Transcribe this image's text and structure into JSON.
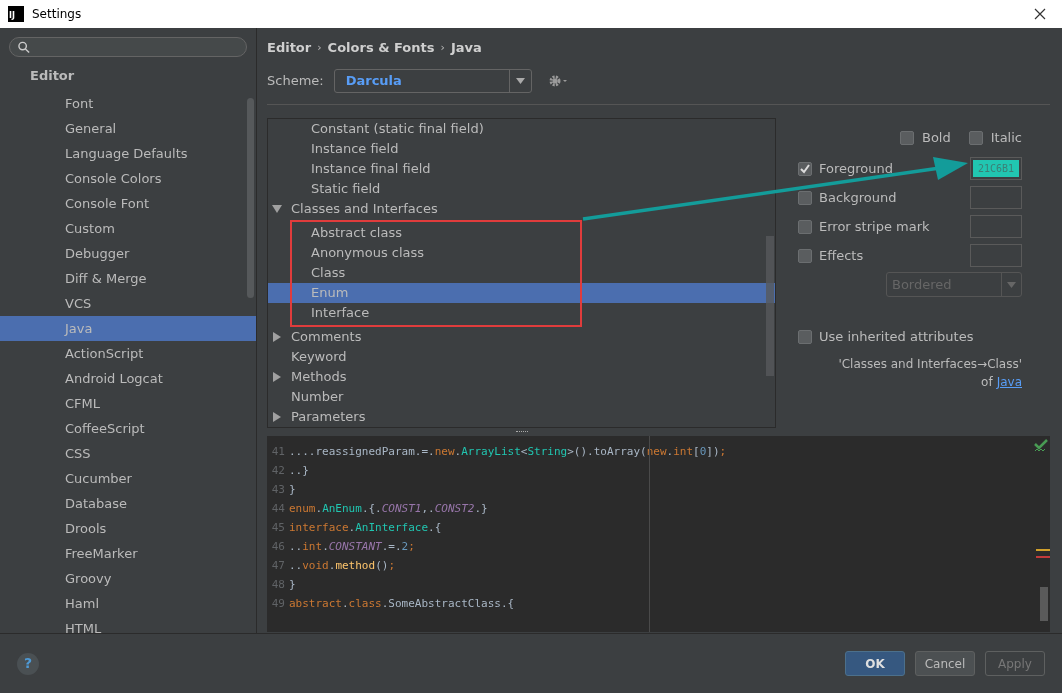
{
  "window": {
    "title": "Settings",
    "app_icon": "IJ"
  },
  "sidebar": {
    "header": "Editor",
    "items": [
      {
        "label": "Font",
        "selected": false
      },
      {
        "label": "General",
        "selected": false
      },
      {
        "label": "Language Defaults",
        "selected": false
      },
      {
        "label": "Console Colors",
        "selected": false
      },
      {
        "label": "Console Font",
        "selected": false
      },
      {
        "label": "Custom",
        "selected": false
      },
      {
        "label": "Debugger",
        "selected": false
      },
      {
        "label": "Diff & Merge",
        "selected": false
      },
      {
        "label": "VCS",
        "selected": false
      },
      {
        "label": "Java",
        "selected": true
      },
      {
        "label": "ActionScript",
        "selected": false
      },
      {
        "label": "Android Logcat",
        "selected": false
      },
      {
        "label": "CFML",
        "selected": false
      },
      {
        "label": "CoffeeScript",
        "selected": false
      },
      {
        "label": "CSS",
        "selected": false
      },
      {
        "label": "Cucumber",
        "selected": false
      },
      {
        "label": "Database",
        "selected": false
      },
      {
        "label": "Drools",
        "selected": false
      },
      {
        "label": "FreeMarker",
        "selected": false
      },
      {
        "label": "Groovy",
        "selected": false
      },
      {
        "label": "Haml",
        "selected": false
      },
      {
        "label": "HTML",
        "selected": false
      }
    ]
  },
  "breadcrumb": {
    "separator": "›",
    "items": [
      "Editor",
      "Colors & Fonts",
      "Java"
    ]
  },
  "scheme": {
    "label": "Scheme:",
    "value": "Darcula"
  },
  "tree": {
    "scrolled_parent_children": [
      {
        "label": "Constant (static final field)",
        "selected": false
      },
      {
        "label": "Instance field",
        "selected": false
      },
      {
        "label": "Instance final field",
        "selected": false
      },
      {
        "label": "Static field",
        "selected": false
      }
    ],
    "items": [
      {
        "label": "Classes and Interfaces",
        "selected": false,
        "expanded": true,
        "children": [
          {
            "label": "Abstract class",
            "selected": false
          },
          {
            "label": "Anonymous class",
            "selected": false
          },
          {
            "label": "Class",
            "selected": false
          },
          {
            "label": "Enum",
            "selected": true
          },
          {
            "label": "Interface",
            "selected": false
          }
        ]
      },
      {
        "label": "Comments",
        "selected": false,
        "expanded": false
      },
      {
        "label": "Keyword",
        "selected": false
      },
      {
        "label": "Methods",
        "selected": false,
        "expanded": false
      },
      {
        "label": "Number",
        "selected": false
      },
      {
        "label": "Parameters",
        "selected": false,
        "expanded": false
      }
    ]
  },
  "attributes": {
    "bold": {
      "label": "Bold",
      "checked": false
    },
    "italic": {
      "label": "Italic",
      "checked": false
    },
    "effects": [
      {
        "label": "Foreground",
        "checked": true,
        "color": "#21c6b1",
        "value": "21C6B1"
      },
      {
        "label": "Background",
        "checked": false
      },
      {
        "label": "Error stripe mark",
        "checked": false
      },
      {
        "label": "Effects",
        "checked": false
      }
    ],
    "effect_type": {
      "value": "Bordered",
      "disabled": true
    },
    "inherit": {
      "label": "Use inherited attributes",
      "checked": false
    },
    "inherit_note": "'Classes and Interfaces→Class'",
    "inherit_of": "of",
    "inherit_link": "Java"
  },
  "preview": {
    "lines": [
      {
        "number": "41",
        "tokens": [
          {
            "kind": "plain",
            "text": "....reassignedParam.=."
          },
          {
            "kind": "keyword",
            "text": "new"
          },
          {
            "kind": "plain",
            "text": "."
          },
          {
            "kind": "class",
            "text": "ArrayList"
          },
          {
            "kind": "plain",
            "text": "<"
          },
          {
            "kind": "class",
            "text": "String"
          },
          {
            "kind": "plain",
            "text": ">().toArray("
          },
          {
            "kind": "keyword",
            "text": "new"
          },
          {
            "kind": "plain",
            "text": "."
          },
          {
            "kind": "keyword",
            "text": "int"
          },
          {
            "kind": "plain",
            "text": "["
          },
          {
            "kind": "number",
            "text": "0"
          },
          {
            "kind": "plain",
            "text": "])"
          },
          {
            "kind": "keyword",
            "text": ";"
          }
        ]
      },
      {
        "number": "42",
        "tokens": [
          {
            "kind": "plain",
            "text": "..}"
          }
        ]
      },
      {
        "number": "43",
        "tokens": [
          {
            "kind": "plain",
            "text": "}"
          }
        ]
      },
      {
        "number": "44",
        "tokens": [
          {
            "kind": "keyword",
            "text": "enum"
          },
          {
            "kind": "plain",
            "text": "."
          },
          {
            "kind": "class",
            "text": "AnEnum"
          },
          {
            "kind": "plain",
            "text": ".{."
          },
          {
            "kind": "constant",
            "text": "CONST1"
          },
          {
            "kind": "plain",
            "text": ",."
          },
          {
            "kind": "constant",
            "text": "CONST2"
          },
          {
            "kind": "plain",
            "text": ".}"
          }
        ]
      },
      {
        "number": "45",
        "tokens": [
          {
            "kind": "keyword",
            "text": "interface"
          },
          {
            "kind": "plain",
            "text": "."
          },
          {
            "kind": "class",
            "text": "AnInterface"
          },
          {
            "kind": "plain",
            "text": ".{"
          }
        ]
      },
      {
        "number": "46",
        "tokens": [
          {
            "kind": "plain",
            "text": ".."
          },
          {
            "kind": "keyword",
            "text": "int"
          },
          {
            "kind": "plain",
            "text": "."
          },
          {
            "kind": "constant",
            "text": "CONSTANT"
          },
          {
            "kind": "plain",
            "text": ".=."
          },
          {
            "kind": "number",
            "text": "2"
          },
          {
            "kind": "keyword",
            "text": ";"
          }
        ]
      },
      {
        "number": "47",
        "tokens": [
          {
            "kind": "plain",
            "text": ".."
          },
          {
            "kind": "keyword",
            "text": "void"
          },
          {
            "kind": "plain",
            "text": "."
          },
          {
            "kind": "method",
            "text": "method"
          },
          {
            "kind": "plain",
            "text": "()"
          },
          {
            "kind": "keyword",
            "text": ";"
          }
        ]
      },
      {
        "number": "48",
        "tokens": [
          {
            "kind": "plain",
            "text": "}"
          }
        ]
      },
      {
        "number": "49",
        "tokens": [
          {
            "kind": "keyword",
            "text": "abstract"
          },
          {
            "kind": "plain",
            "text": "."
          },
          {
            "kind": "keyword",
            "text": "class"
          },
          {
            "kind": "plain",
            "text": ".SomeAbstractClass.{"
          }
        ]
      }
    ]
  },
  "help": "?",
  "buttons": [
    {
      "label": "OK",
      "kind": "default",
      "disabled": false
    },
    {
      "label": "Cancel",
      "kind": "normal",
      "disabled": false
    },
    {
      "label": "Apply",
      "kind": "normal",
      "disabled": true
    }
  ]
}
